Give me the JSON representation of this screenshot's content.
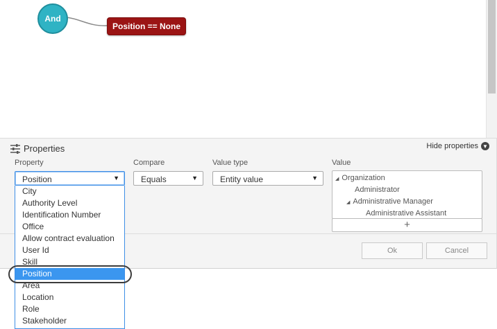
{
  "canvas": {
    "and_node": "And",
    "condition_node": "Position == None",
    "condition_color": "#9b1414",
    "and_color": "#2fb3c4"
  },
  "properties": {
    "title": "Properties",
    "icon": "sliders-icon",
    "hide_label": "Hide properties",
    "hide_icon": "chevron-down-circle-icon",
    "property_label": "Property",
    "property_value": "Position",
    "compare_label": "Compare",
    "compare_value": "Equals",
    "value_type_label": "Value type",
    "value_type_value": "Entity value",
    "value_label": "Value",
    "value_tree": [
      {
        "label": "Organization",
        "expanded": true
      },
      {
        "label": "Administrator"
      },
      {
        "label": "Administrative Manager",
        "expanded": true
      },
      {
        "label": "Administrative Assistant"
      }
    ],
    "add_symbol": "+",
    "ok_label": "Ok",
    "cancel_label": "Cancel"
  },
  "dropdown": {
    "items": [
      "City",
      "Authority Level",
      "Identification Number",
      "Office",
      "Allow contract evaluation",
      "User Id",
      "Skill",
      "Position",
      "Area",
      "Location",
      "Role",
      "Stakeholder"
    ],
    "selected": "Position",
    "selected_color": "#3b96ef"
  }
}
